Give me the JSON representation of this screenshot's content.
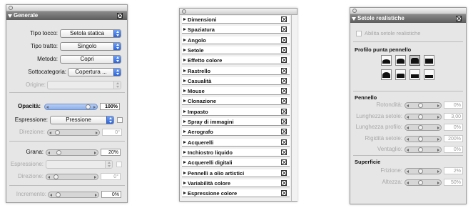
{
  "panel1": {
    "header": "Generale",
    "rows": [
      {
        "label": "Tipo tocco:",
        "value": "Setola statica"
      },
      {
        "label": "Tipo tratto:",
        "value": "Singolo"
      },
      {
        "label": "Metodo:",
        "value": "Copri"
      },
      {
        "label": "Sottocategoria:",
        "value": "Copertura ..."
      },
      {
        "label": "Origine:",
        "value": ""
      }
    ],
    "opacity": {
      "label": "Opacità:",
      "value": "100%",
      "level": 1.0
    },
    "expression": {
      "label": "Espressione:",
      "value": "Pressione"
    },
    "direzione1": {
      "label": "Direzione:",
      "value": "0°"
    },
    "grana": {
      "label": "Grana:",
      "value": "20%"
    },
    "espressione2": {
      "label": "Espressione:"
    },
    "direzione2": {
      "label": "Direzione:",
      "value": "0°"
    },
    "incremento": {
      "label": "Incremento:",
      "value": "0%"
    }
  },
  "panel2": {
    "items": [
      "Dimensioni",
      "Spaziatura",
      "Angolo",
      "Setole",
      "Effetto colore",
      "Rastrello",
      "Casualità",
      "Mouse",
      "Clonazione",
      "Impasto",
      "Spray di immagini",
      "Aerografo",
      "Acquerelli",
      "Inchiostro liquido",
      "Acquerelli digitali",
      "Pennelli a olio artistici",
      "Variabilità colore",
      "Espressione colore"
    ]
  },
  "panel3": {
    "header": "Setole realistiche",
    "enable_label": "Abilita setole realistiche",
    "profile_title": "Profilo punta pennello",
    "brush_title": "Pennello",
    "brush_rows": [
      {
        "label": "Rotondità:",
        "value": "0%"
      },
      {
        "label": "Lunghezza setole:",
        "value": "3,00"
      },
      {
        "label": "Lunghezza profilo:",
        "value": "0%"
      },
      {
        "label": "Rigidità setole:",
        "value": "200%"
      },
      {
        "label": "Ventaglio:",
        "value": "0%"
      }
    ],
    "surface_title": "Superficie",
    "surface_rows": [
      {
        "label": "Frizione:",
        "value": "2%"
      },
      {
        "label": "Altezza:",
        "value": "50%"
      }
    ]
  }
}
